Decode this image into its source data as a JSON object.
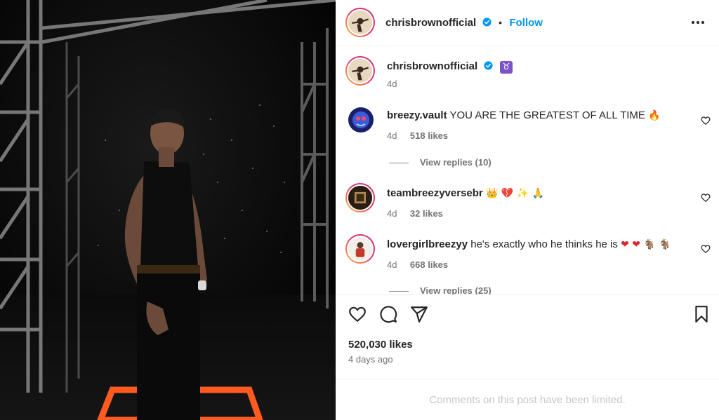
{
  "post": {
    "author": "chrisbrownofficial",
    "follow_label": "Follow",
    "separator": "•",
    "caption_emoji": "♉",
    "caption_time": "4d",
    "likes_count": "520,030 likes",
    "posted_ago": "4 days ago",
    "comments_limited_notice": "Comments on this post have been limited."
  },
  "comments": [
    {
      "username": "breezy.vault",
      "text": "YOU ARE THE GREATEST OF ALL TIME",
      "emoji": "🔥",
      "time": "4d",
      "likes": "518 likes",
      "view_replies": "View replies (10)"
    },
    {
      "username": "teambreezyversebr",
      "text": "",
      "emoji": "👑 💔 ✨ 🙏",
      "time": "4d",
      "likes": "32 likes"
    },
    {
      "username": "lovergirlbreezyy",
      "text": "he's exactly who he thinks he is",
      "emoji": "❤ ❤ 🐐 🐐",
      "time": "4d",
      "likes": "668 likes",
      "view_replies": "View replies (25)"
    }
  ],
  "icons": {
    "verified": "verified-badge-icon",
    "more": "more-options-icon",
    "like": "heart-icon",
    "comment": "comment-icon",
    "share": "send-icon",
    "save": "bookmark-icon"
  },
  "colors": {
    "accent": "#0095f6",
    "text": "#262626",
    "secondary": "#737373",
    "muted": "#c7c7c7",
    "stage_marking": "#ff5a1f"
  }
}
